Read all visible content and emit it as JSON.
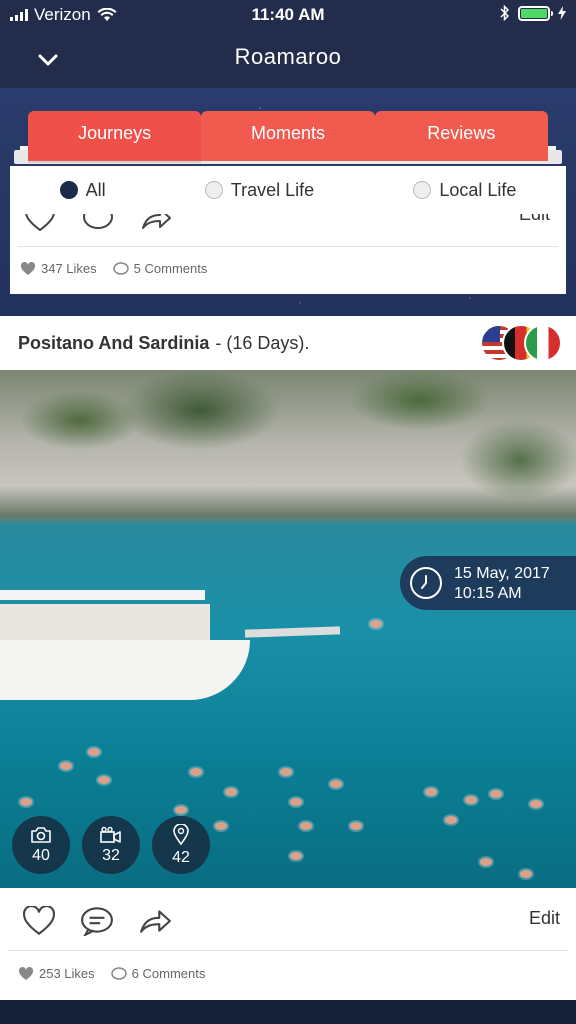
{
  "status": {
    "carrier": "Verizon",
    "time": "11:40 AM"
  },
  "nav": {
    "title": "Roamaroo"
  },
  "tabs": [
    {
      "label": "Journeys"
    },
    {
      "label": "Moments"
    },
    {
      "label": "Reviews"
    }
  ],
  "filters": [
    {
      "label": "All",
      "selected": true
    },
    {
      "label": "Travel Life",
      "selected": false
    },
    {
      "label": "Local Life",
      "selected": false
    }
  ],
  "card1": {
    "likes": "347 Likes",
    "comments": "5 Comments",
    "edit_label": "Edit"
  },
  "card2": {
    "title": "Positano And Sardinia",
    "duration": "- (16 Days).",
    "date": "15 May, 2017",
    "time": "10:15 AM",
    "photos": "40",
    "videos": "32",
    "locations": "42",
    "likes": "253 Likes",
    "comments": "6 Comments",
    "edit_label": "Edit",
    "flags": [
      "usa-flag",
      "germany-flag",
      "italy-flag"
    ]
  },
  "colors": {
    "nav_bg": "#232d4b",
    "tab_red": "#f05a4f",
    "radio_selected": "#1e2a4a",
    "battery": "#4cd964"
  }
}
